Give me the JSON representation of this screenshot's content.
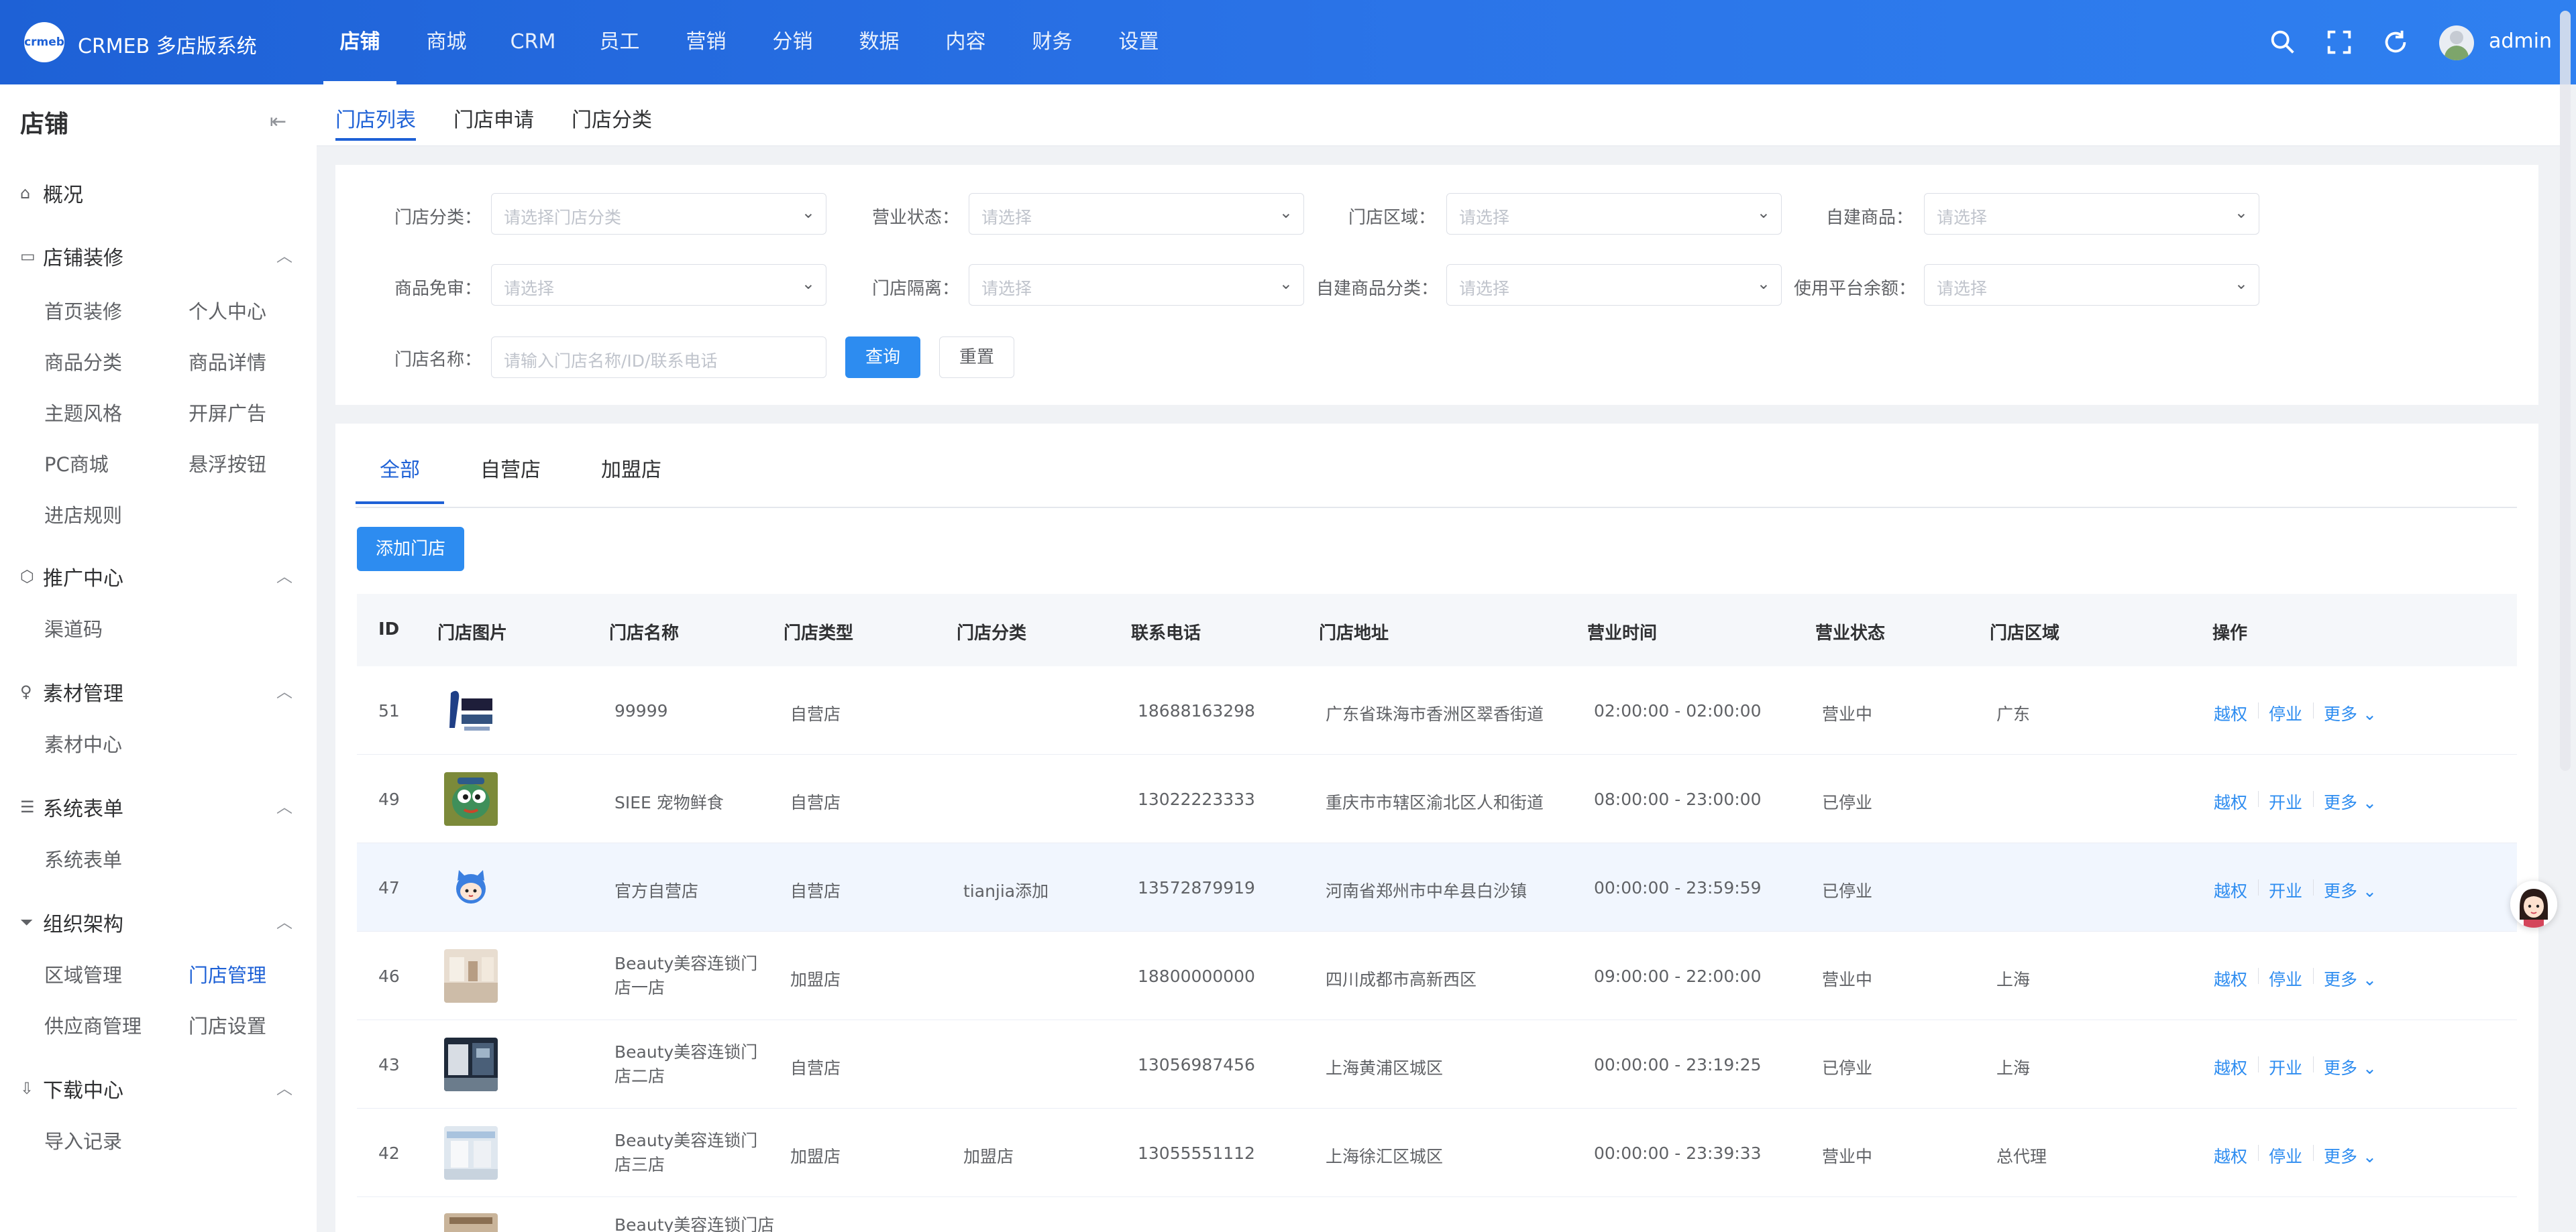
{
  "header": {
    "logo_text": "crmeb",
    "brand": "CRMEB 多店版系统",
    "nav": [
      "店铺",
      "商城",
      "CRM",
      "员工",
      "营销",
      "分销",
      "数据",
      "内容",
      "财务",
      "设置"
    ],
    "active_nav": "店铺",
    "username": "admin",
    "icons": [
      "search-icon",
      "fullscreen-icon",
      "refresh-icon"
    ]
  },
  "sidebar": {
    "title": "店铺",
    "groups": [
      {
        "label": "概况",
        "icon": "home-icon"
      },
      {
        "label": "店铺装修",
        "icon": "monitor-icon",
        "items": [
          "首页装修",
          "个人中心",
          "商品分类",
          "商品详情",
          "主题风格",
          "开屏广告",
          "PC商城",
          "悬浮按钮",
          "进店规则"
        ]
      },
      {
        "label": "推广中心",
        "icon": "box-icon",
        "items": [
          "渠道码"
        ]
      },
      {
        "label": "素材管理",
        "icon": "bulb-icon",
        "items": [
          "素材中心"
        ]
      },
      {
        "label": "系统表单",
        "icon": "sliders-icon",
        "items": [
          "系统表单"
        ]
      },
      {
        "label": "组织架构",
        "icon": "filter-icon",
        "items": [
          "区域管理",
          "门店管理",
          "供应商管理",
          "门店设置"
        ]
      },
      {
        "label": "下载中心",
        "icon": "download-icon",
        "items": [
          "导入记录"
        ]
      }
    ],
    "active_item": "门店管理"
  },
  "subtabs": [
    "门店列表",
    "门店申请",
    "门店分类"
  ],
  "filters": {
    "labels": [
      "门店分类：",
      "营业状态：",
      "门店区域：",
      "自建商品：",
      "商品免审：",
      "门店隔离：",
      "自建商品分类：",
      "使用平台余额：",
      "门店名称："
    ],
    "placeholders": {
      "category": "请选择门店分类",
      "select": "请选择",
      "name": "请输入门店名称/ID/联系电话"
    },
    "query_btn": "查询",
    "reset_btn": "重置"
  },
  "list": {
    "tabs": [
      "全部",
      "自营店",
      "加盟店"
    ],
    "add_btn": "添加门店",
    "columns": [
      "ID",
      "门店图片",
      "门店名称",
      "门店类型",
      "门店分类",
      "联系电话",
      "门店地址",
      "营业时间",
      "营业状态",
      "门店区域",
      "操作"
    ],
    "rows": [
      {
        "id": "51",
        "name": "99999",
        "type": "自营店",
        "category": "",
        "phone": "18688163298",
        "address": "广东省珠海市香洲区翠香街道",
        "hours": "02:00:00 - 02:00:00",
        "status": "营业中",
        "region": "广东",
        "ops": [
          "越权",
          "停业",
          "更多"
        ]
      },
      {
        "id": "49",
        "name": "SIEE 宠物鲜食",
        "type": "自营店",
        "category": "",
        "phone": "13022223333",
        "address": "重庆市市辖区渝北区人和街道",
        "hours": "08:00:00 - 23:00:00",
        "status": "已停业",
        "region": "",
        "ops": [
          "越权",
          "开业",
          "更多"
        ]
      },
      {
        "id": "47",
        "name": "官方自营店",
        "type": "自营店",
        "category": "tianjia添加",
        "phone": "13572879919",
        "address": "河南省郑州市中牟县白沙镇",
        "hours": "00:00:00 - 23:59:59",
        "status": "已停业",
        "region": "",
        "ops": [
          "越权",
          "开业",
          "更多"
        ]
      },
      {
        "id": "46",
        "name": "Beauty美容连锁门店一店",
        "type": "加盟店",
        "category": "",
        "phone": "18800000000",
        "address": "四川成都市高新西区",
        "hours": "09:00:00 - 22:00:00",
        "status": "营业中",
        "region": "上海",
        "ops": [
          "越权",
          "停业",
          "更多"
        ]
      },
      {
        "id": "43",
        "name": "Beauty美容连锁门店二店",
        "type": "自营店",
        "category": "",
        "phone": "13056987456",
        "address": "上海黄浦区城区",
        "hours": "00:00:00 - 23:19:25",
        "status": "已停业",
        "region": "上海",
        "ops": [
          "越权",
          "开业",
          "更多"
        ]
      },
      {
        "id": "42",
        "name": "Beauty美容连锁门店三店",
        "type": "加盟店",
        "category": "加盟店",
        "phone": "13055551112",
        "address": "上海徐汇区城区",
        "hours": "00:00:00 - 23:39:33",
        "status": "营业中",
        "region": "总代理",
        "ops": [
          "越权",
          "停业",
          "更多"
        ]
      },
      {
        "id": "",
        "name": "Beauty美容连锁门店",
        "type": "",
        "category": "",
        "phone": "",
        "address": "",
        "hours": "",
        "status": "",
        "region": "",
        "ops": []
      }
    ]
  },
  "colors": {
    "primary": "#1e61d6",
    "button": "#2d8cf0",
    "link": "#2d8cf0"
  }
}
